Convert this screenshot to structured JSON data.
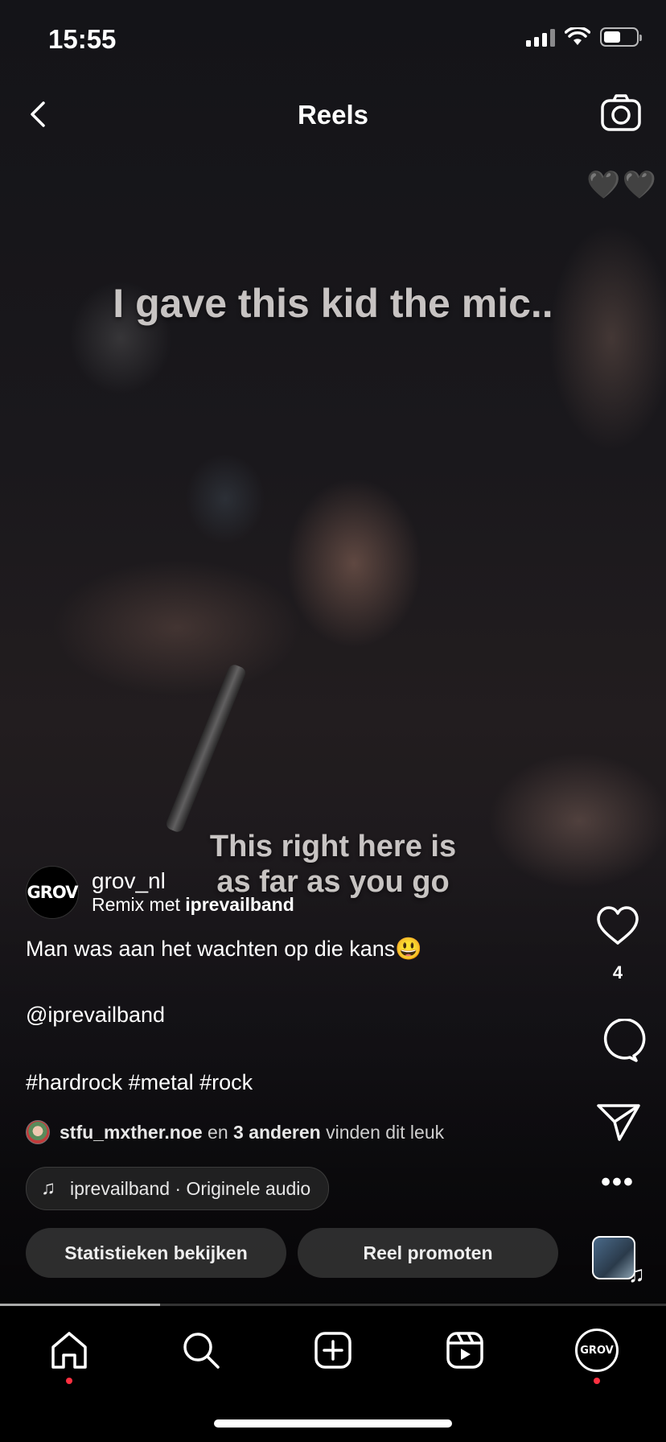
{
  "status_bar": {
    "time": "15:55",
    "battery_level": 0.5
  },
  "header": {
    "title": "Reels"
  },
  "video": {
    "overlay_top": "I gave this kid the mic..",
    "overlay_bottom_line1": "This right here is",
    "overlay_bottom_line2": "as far as you go",
    "corner_emoji": "🖤🖤",
    "playback_progress": 0.24
  },
  "post": {
    "avatar_text": "GROV",
    "username": "grov_nl",
    "remix_prefix": "Remix met",
    "remix_user": "iprevailband",
    "caption": "Man was aan het wachten op die kans😃",
    "mention": "@iprevailband",
    "hashtags": "#hardrock #metal #rock",
    "likes": {
      "user": "stfu_mxther.noe",
      "en": "en",
      "others": "3 anderen",
      "suffix": "vinden dit leuk"
    },
    "audio": "iprevailband · Originele audio"
  },
  "buttons": {
    "stats": "Statistieken bekijken",
    "promote": "Reel promoten"
  },
  "actions": {
    "like_count": "4",
    "more": "•••"
  },
  "nav": {
    "profile_avatar_text": "GROV"
  },
  "colors": {
    "notification_dot": "#ff3040"
  }
}
